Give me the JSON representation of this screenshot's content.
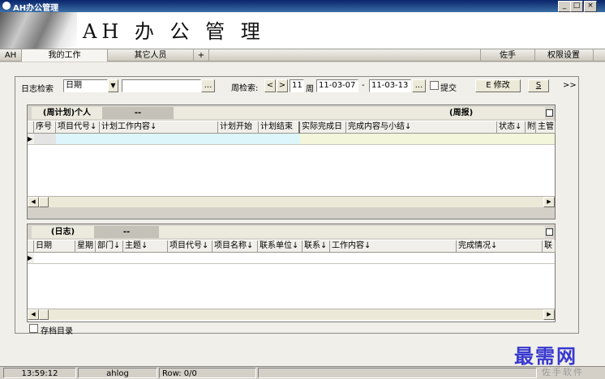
{
  "window": {
    "title": "AH办公管理",
    "min": "_",
    "max": "□",
    "close": "×"
  },
  "banner": {
    "title": "AH 办 公 管 理"
  },
  "top_tabs": [
    {
      "label": "AH"
    },
    {
      "label": "我的工作"
    },
    {
      "label": "其它人员"
    },
    {
      "label": "+"
    },
    {
      "label": "佐手"
    },
    {
      "label": "权限设置"
    }
  ],
  "search": {
    "label": "日志检索",
    "type_value": "日期",
    "dots": "...",
    "week_label": "周检索:",
    "prev": "<",
    "next": ">",
    "week_num": "11",
    "week_word": "周",
    "date_from": "11-03-07",
    "dash": "-",
    "date_to": "11-03-13",
    "submit_label": "提交",
    "edit_label": "E 修改",
    "s_label": "S",
    "more": ">>"
  },
  "plan_grid": {
    "tab_active": "(周计划)个人",
    "tab_other": "--",
    "right_title": "(周报)",
    "columns": [
      "序号",
      "项目代号↓",
      "计划工作内容↓",
      "计划开始",
      "计划结束",
      "实际完成日",
      "完成内容与小结↓",
      "状态↓",
      "附",
      "主管"
    ]
  },
  "log_grid": {
    "tab_active": "(日志)",
    "tab_other": "--",
    "columns": [
      "日期",
      "星期",
      "部门↓",
      "主题↓",
      "项目代号↓",
      "项目名称↓",
      "联系单位↓",
      "联系↓",
      "工作内容↓",
      "完成情况↓",
      "联"
    ]
  },
  "archive_label": "存档目录",
  "status": {
    "time": "13:59:12",
    "user": "ahlog",
    "row": "Row: 0/0"
  },
  "watermark": {
    "brand": "最需网",
    "sub": "佐手软件"
  },
  "row_marker": "▶"
}
